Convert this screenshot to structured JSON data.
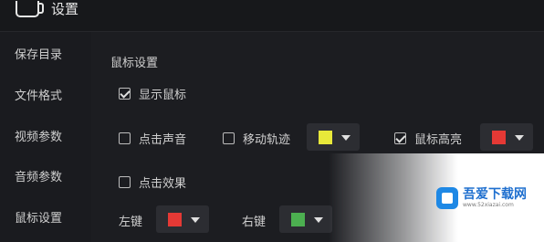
{
  "window": {
    "title": "设置",
    "icon": "camera-icon"
  },
  "sidebar": {
    "items": [
      {
        "label": "保存目录"
      },
      {
        "label": "文件格式"
      },
      {
        "label": "视频参数"
      },
      {
        "label": "音频参数"
      },
      {
        "label": "鼠标设置"
      }
    ]
  },
  "main": {
    "section_title": "鼠标设置",
    "show_cursor": {
      "label": "显示鼠标",
      "checked": true
    },
    "click_sound": {
      "label": "点击声音",
      "checked": false
    },
    "move_trail": {
      "label": "移动轨迹",
      "checked": false,
      "color": "#e8e83a"
    },
    "cursor_highlight": {
      "label": "鼠标高亮",
      "checked": true,
      "color": "#e53935"
    },
    "click_effect": {
      "label": "点击效果",
      "checked": false
    },
    "left_key": {
      "label": "左键",
      "color": "#e53935"
    },
    "right_key": {
      "label": "右键",
      "color": "#4caf50"
    }
  },
  "watermark": {
    "name": "吾爱下载网",
    "site": "www.52xiazai.com"
  }
}
